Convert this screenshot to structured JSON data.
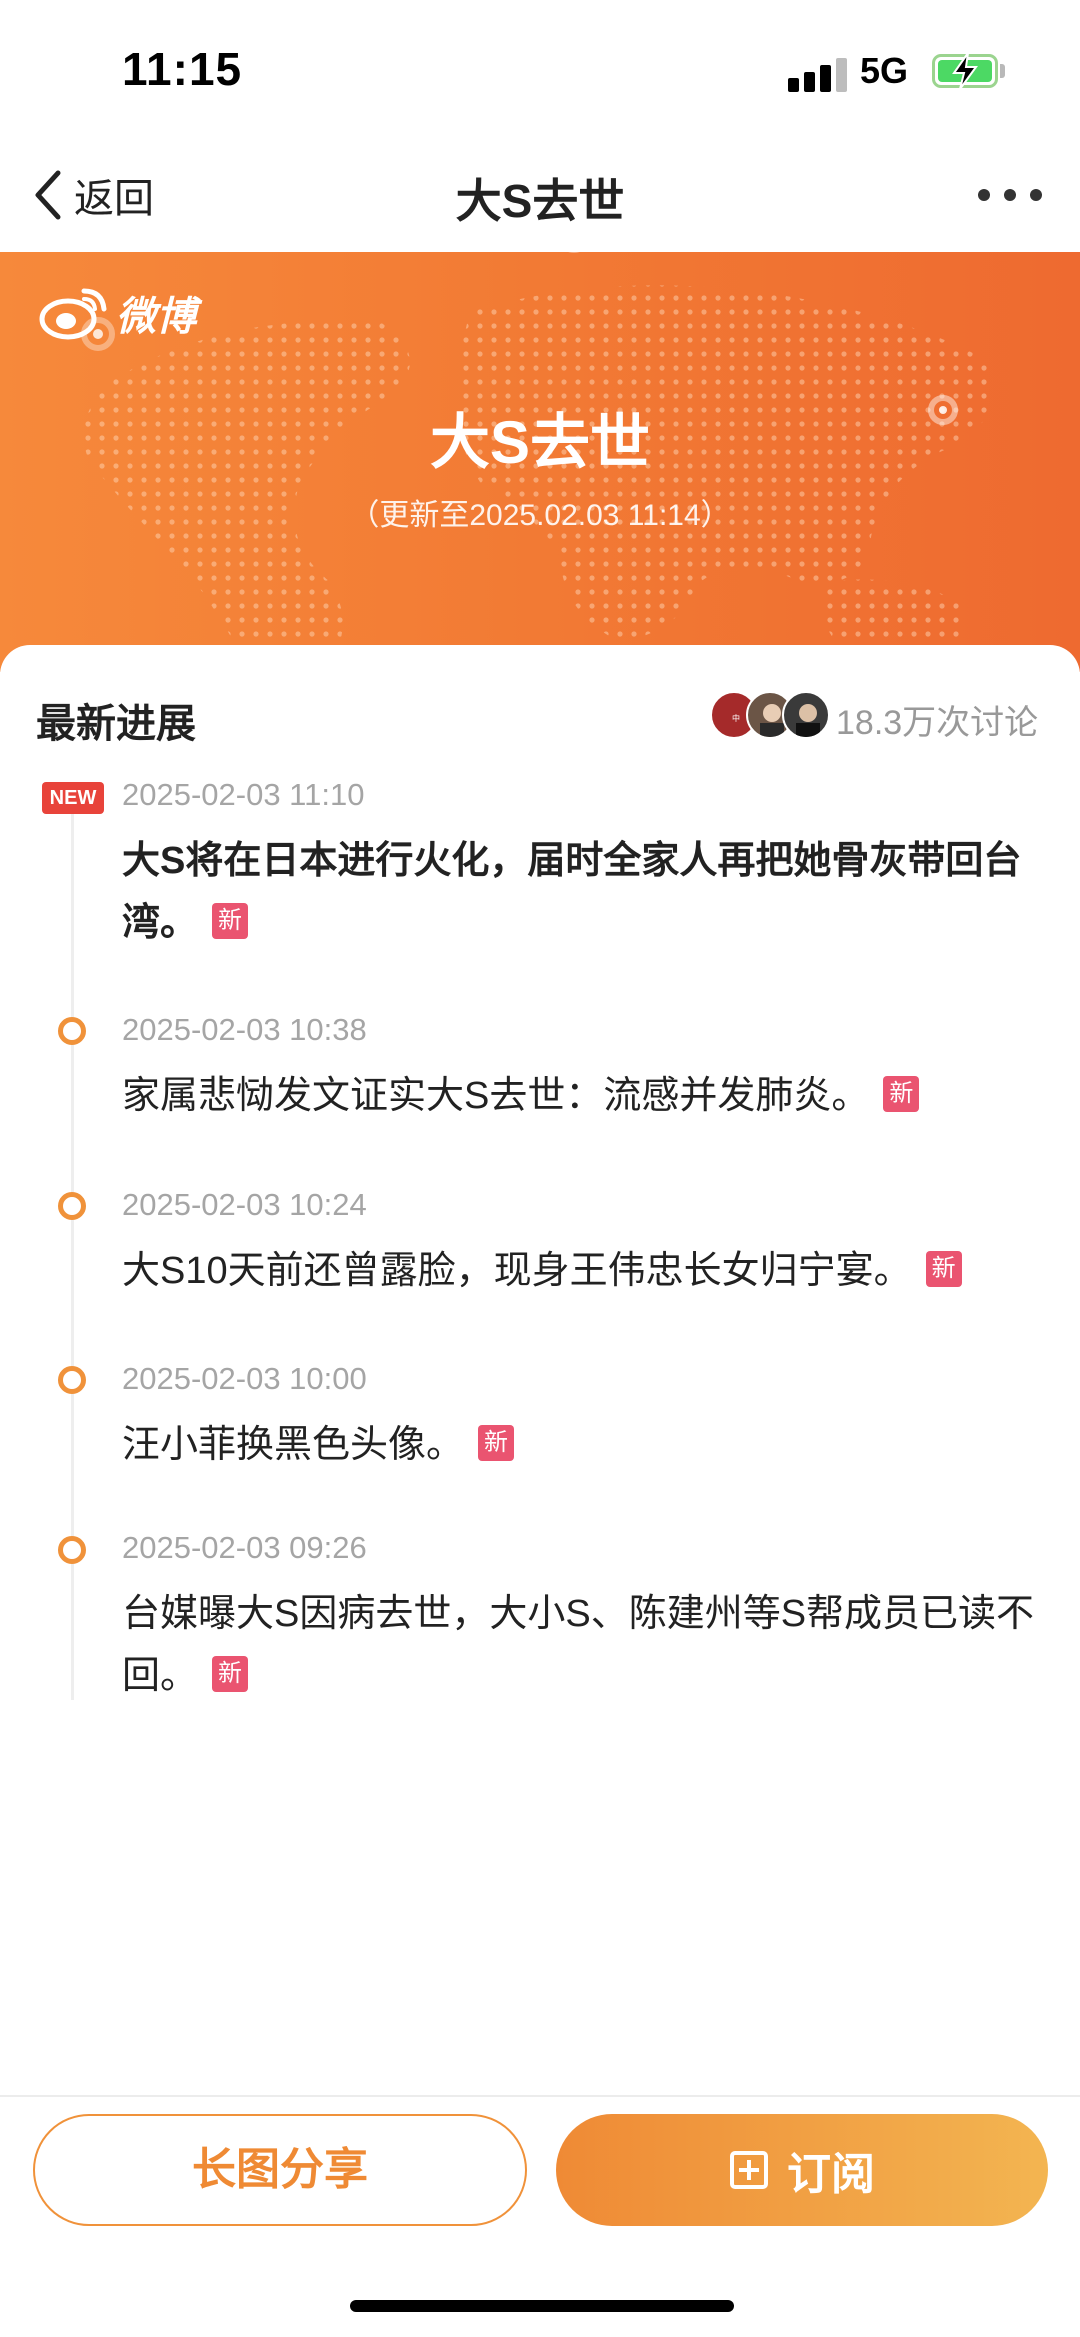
{
  "status_bar": {
    "time": "11:15",
    "network": "5G"
  },
  "nav": {
    "back_label": "返回",
    "title": "大S去世",
    "back_icon": "chevron-left-icon",
    "more_icon": "more-dots-icon"
  },
  "banner": {
    "brand": "微博",
    "title": "大S去世",
    "updated": "（更新至2025.02.03 11:14）"
  },
  "section": {
    "title": "最新进展",
    "discussion_count": "18.3万次讨论"
  },
  "timeline": [
    {
      "time": "2025-02-03 11:10",
      "text": "大S将在日本进行火化，届时全家人再把她骨灰带回台湾。",
      "tag": "新",
      "is_latest": true,
      "latest_label": "NEW"
    },
    {
      "time": "2025-02-03 10:38",
      "text": "家属悲恸发文证实大S去世：流感并发肺炎。",
      "tag": "新",
      "is_latest": false
    },
    {
      "time": "2025-02-03 10:24",
      "text": "大S10天前还曾露脸，现身王伟忠长女归宁宴。",
      "tag": "新",
      "is_latest": false
    },
    {
      "time": "2025-02-03 10:00",
      "text": "汪小菲换黑色头像。",
      "tag": "新",
      "is_latest": false
    },
    {
      "time": "2025-02-03 09:26",
      "text": "台媒曝大S因病去世，大小S、陈建州等S帮成员已读不回。",
      "tag": "新",
      "is_latest": false
    }
  ],
  "bottom": {
    "share_label": "长图分享",
    "subscribe_label": "订阅"
  },
  "colors": {
    "accent": "#f0923a",
    "banner": "#f27a34",
    "tag": "#ea5470",
    "new_badge": "#e8433a"
  }
}
